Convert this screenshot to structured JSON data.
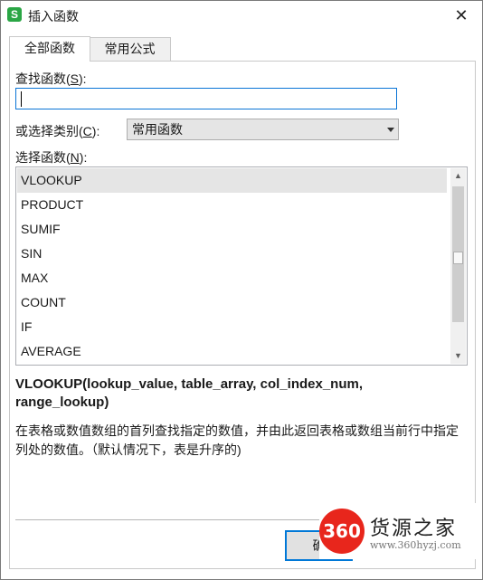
{
  "window": {
    "title": "插入函数",
    "app_icon_letter": "S",
    "close_symbol": "✕"
  },
  "tabs": [
    {
      "label": "全部函数",
      "active": true
    },
    {
      "label": "常用公式",
      "active": false
    }
  ],
  "search": {
    "label_prefix": "查找函数(",
    "label_key": "S",
    "label_suffix": "):",
    "value": ""
  },
  "category": {
    "label_prefix": "或选择类别(",
    "label_key": "C",
    "label_suffix": "):",
    "selected": "常用函数"
  },
  "functions": {
    "label_prefix": "选择函数(",
    "label_key": "N",
    "label_suffix": "):",
    "items": [
      "VLOOKUP",
      "PRODUCT",
      "SUMIF",
      "SIN",
      "MAX",
      "COUNT",
      "IF",
      "AVERAGE"
    ],
    "selected_index": 0
  },
  "detail": {
    "signature": "VLOOKUP(lookup_value, table_array, col_index_num, range_lookup)",
    "description": "在表格或数值数组的首列查找指定的数值，并由此返回表格或数组当前行中指定列处的数值。（默认情况下，表是升序的)"
  },
  "buttons": {
    "ok_visible": "确"
  },
  "watermark": {
    "logo_text": "360",
    "name": "货源之家",
    "url": "www.360hyzj.com"
  }
}
